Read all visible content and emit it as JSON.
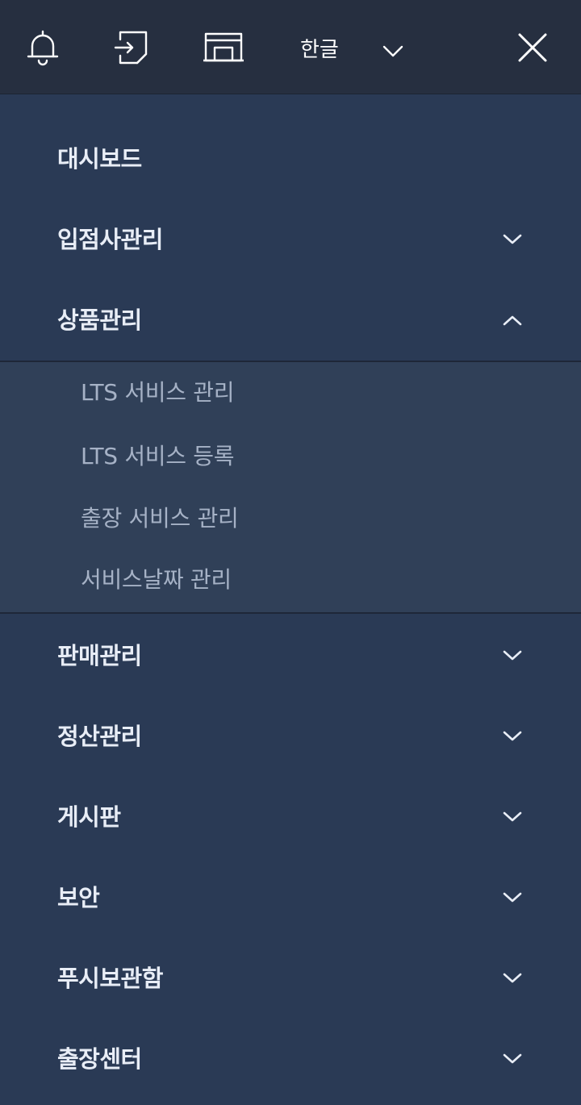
{
  "topbar": {
    "icons": {
      "notifications": "bell-icon",
      "login": "login-icon",
      "store": "store-icon",
      "close": "close-icon"
    },
    "language": {
      "selected": "한글",
      "chevron": "chevron-down-icon"
    }
  },
  "menu": {
    "items": [
      {
        "label": "대시보드"
      },
      {
        "label": "입점사관리",
        "chevron": "chevron-down-icon"
      },
      {
        "label": "상품관리",
        "chevron": "chevron-up-icon",
        "expanded": true,
        "children": [
          {
            "label": "LTS 서비스 관리"
          },
          {
            "label": "LTS 서비스 등록"
          },
          {
            "label": "출장 서비스 관리"
          },
          {
            "label": "서비스날짜 관리"
          }
        ]
      },
      {
        "label": "판매관리",
        "chevron": "chevron-down-icon"
      },
      {
        "label": "정산관리",
        "chevron": "chevron-down-icon"
      },
      {
        "label": "게시판",
        "chevron": "chevron-down-icon"
      },
      {
        "label": "보안",
        "chevron": "chevron-down-icon"
      },
      {
        "label": "푸시보관함",
        "chevron": "chevron-down-icon"
      },
      {
        "label": "출장센터",
        "chevron": "chevron-down-icon"
      }
    ]
  },
  "colors": {
    "topbar_bg": "#262f40",
    "menu_bg": "#2a3a55",
    "submenu_bg": "#304058",
    "menu_text": "#e8edf6",
    "submenu_text": "#a6b2c6"
  }
}
